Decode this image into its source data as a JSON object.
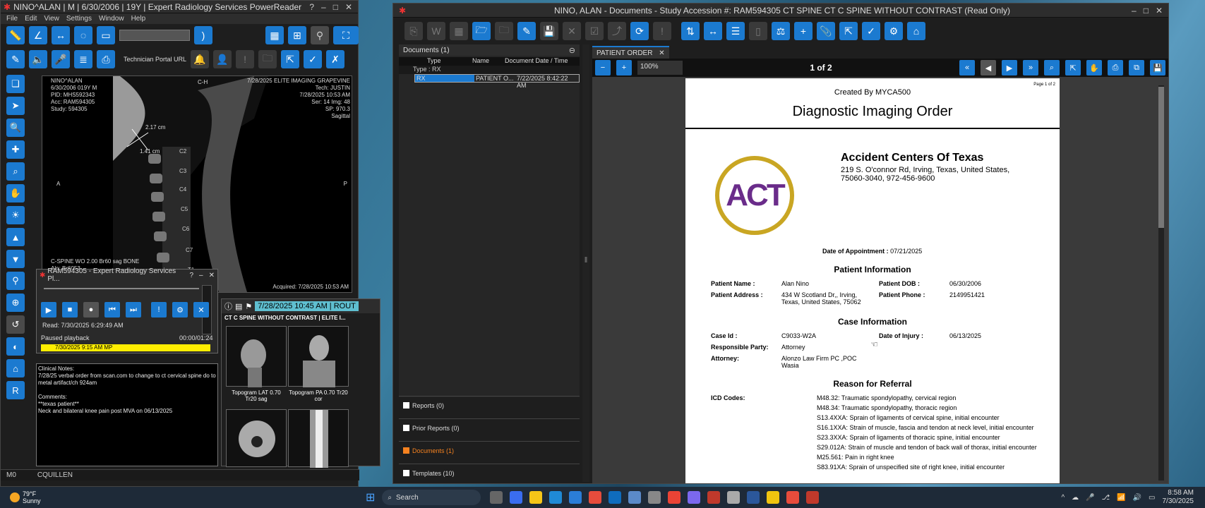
{
  "left_window": {
    "title": "NINO^ALAN | M | 6/30/2006 | 19Y | Expert Radiology Services PowerReader",
    "menu": [
      "File",
      "Edit",
      "View",
      "Settings",
      "Window",
      "Help"
    ],
    "technician_portal": "Technician Portal URL",
    "viewer": {
      "overlay_tl": [
        "NINO^ALAN",
        "6/30/2006 019Y M",
        "PID: MHS592343",
        "Acc: RAM594305",
        "Study: 594305"
      ],
      "overlay_tr": [
        "7/28/2025 ELITE IMAGING GRAPEVINE",
        "Tech: JUSTIN",
        "7/28/2025 10:53 AM",
        "Ser: 14 Img: 48",
        "SP: 970.3",
        "Sagittal"
      ],
      "overlay_bl": [
        "C-SPINE WO 2.00 Br60 sag BONE",
        "Aln: Br6053"
      ],
      "overlay_br": "Acquired: 7/28/2025 10:53 AM",
      "measure1": "2.17 cm",
      "measure2": "1.41 cm",
      "vertebrae": [
        "C2",
        "C3",
        "C4",
        "C5",
        "C6",
        "C7",
        "T1"
      ],
      "marker_a": "A",
      "marker_p": "P",
      "marker_ch": "C-H"
    },
    "status_left": "M0",
    "status_user": "CQUILLEN"
  },
  "playback": {
    "title": "RAM594305 - Expert Radiology Services Pl...",
    "read_label": "Read:  7/30/2025 6:29:49 AM",
    "status": "Paused playback",
    "time": "00:00/01:24",
    "yellow_row": "7/30/2025 9:15 AM    MP"
  },
  "notes": {
    "lines": [
      "Clinical Notes:",
      "7/28/25 verbal order from scan.com to change to ct cervical spine do to",
      "metal artifact/ch 924am",
      "",
      "Comments:",
      "**texas patient**",
      "Neck and bilateral knee pain post MVA on 06/13/2025"
    ]
  },
  "series_panel": {
    "header": "7/28/2025 10:45 AM | ROUT",
    "study": "CT C SPINE WITHOUT CONTRAST | ELITE I...",
    "thumbs": [
      "Topogram LAT 0.70 Tr20 sag",
      "Topogram PA 0.70 Tr20 cor"
    ]
  },
  "right_window": {
    "title": "NINO, ALAN - Documents - Study Accession #: RAM594305 CT SPINE CT C SPINE WITHOUT CONTRAST (Read Only)",
    "documents_header": "Documents (1)",
    "cols": [
      "Type",
      "Name",
      "Document Date / Time"
    ],
    "group": "Type : RX",
    "row": {
      "type": "RX",
      "name": "PATIENT O...",
      "date": "7/22/2025 8:42:22 AM"
    },
    "sections": [
      "Reports (0)",
      "Prior Reports (0)",
      "Documents (1)",
      "Templates (10)"
    ],
    "tab": "PATIENT ORDER",
    "zoom": "100%",
    "page_count": "1 of 2"
  },
  "pdf": {
    "page_label": "Page 1 of 2",
    "created_by": "Created By MYCA500",
    "title": "Diagnostic Imaging Order",
    "logo_text": "ACT",
    "org": "Accident Centers Of Texas",
    "address1": "219 S. O'connor Rd, Irving, Texas, United States,",
    "address2": "75060-3040, 972-456-9600",
    "appt_label": "Date of Appointment :",
    "appt_value": "07/21/2025",
    "patient_h": "Patient Information",
    "name_l": "Patient Name :",
    "name_v": "Alan  Nino",
    "dob_l": "Patient DOB :",
    "dob_v": "06/30/2006",
    "addr_l": "Patient Address :",
    "addr_v1": "434 W Scotland Dr,, Irving,",
    "addr_v2": "Texas, United States, 75062",
    "phone_l": "Patient Phone :",
    "phone_v": "2149951421",
    "case_h": "Case Information",
    "case_l": "Case Id :",
    "case_v": "C9033-W2A",
    "inj_l": "Date of Injury :",
    "inj_v": "06/13/2025",
    "resp_l": "Responsible Party:",
    "resp_v": "Attorney",
    "att_l": "Attorney:",
    "att_v1": "Alonzo Law Firm PC ,POC",
    "att_v2": "Wasia",
    "ref_h": "Reason for Referral",
    "icd_l": "ICD Codes:",
    "icd": [
      "M48.32: Traumatic spondylopathy, cervical region",
      "M48.34: Traumatic spondylopathy, thoracic region",
      "S13.4XXA: Sprain of ligaments of cervical spine, initial encounter",
      "S16.1XXA: Strain of muscle, fascia and tendon at neck level, initial encounter",
      "S23.3XXA: Sprain of ligaments of thoracic spine, initial encounter",
      "S29.012A: Strain of muscle and tendon of back wall of thorax, initial encounter",
      "M25.561: Pain in right knee",
      "S83.91XA: Sprain of unspecified site of right knee, initial encounter"
    ]
  },
  "taskbar": {
    "weather_temp": "79°F",
    "weather_desc": "Sunny",
    "search": "Search",
    "time": "8:58 AM",
    "date": "7/30/2025"
  },
  "colors": {
    "accent": "#1b7ad0",
    "orange": "#f58220",
    "yellow": "#ffee00"
  }
}
